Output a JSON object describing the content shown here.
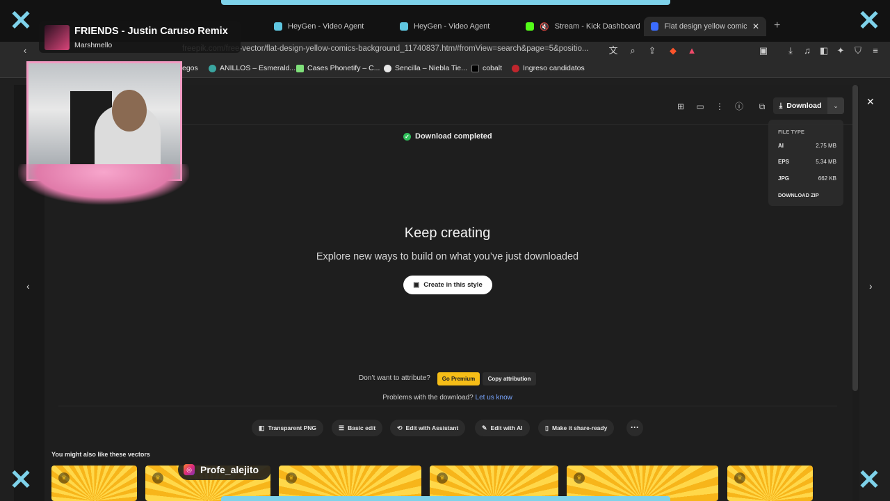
{
  "tabs": [
    {
      "title": "HeyGen - Video Agent",
      "color": "#5fc6e0"
    },
    {
      "title": "HeyGen - Video Agent",
      "color": "#5fc6e0"
    },
    {
      "title": "Stream - Kick Dashboard",
      "color": "#53fc18"
    },
    {
      "title": "Flat design yellow comics b",
      "color": "#3b6cff",
      "active": true
    }
  ],
  "address": {
    "url": "freepik.com/free-vector/flat-design-yellow-comics-background_11740837.htm#fromView=search&page=5&positio..."
  },
  "bookmarks": [
    {
      "label": "egos"
    },
    {
      "label": "ANILLOS – Esmerald..."
    },
    {
      "label": "Cases Phonetify – C..."
    },
    {
      "label": "Sencilla – Niebla Tie..."
    },
    {
      "label": "cobalt"
    },
    {
      "label": "Ingreso candidatos"
    }
  ],
  "download": {
    "button_label": "Download",
    "menu_header": "FILE TYPE",
    "files": [
      {
        "type": "AI",
        "size": "2.75 MB"
      },
      {
        "type": "EPS",
        "size": "5.34 MB"
      },
      {
        "type": "JPG",
        "size": "662 KB"
      }
    ],
    "zip_label": "DOWNLOAD ZIP"
  },
  "status": {
    "completed": "Download completed"
  },
  "hero": {
    "title": "Keep creating",
    "subtitle": "Explore new ways to build on what you’ve just downloaded",
    "cta": "Create in this style"
  },
  "attribution": {
    "question": "Don’t want to attribute?",
    "premium": "Go Premium",
    "copy": "Copy attribution",
    "problems": "Problems with the download?",
    "problems_link": "Let us know"
  },
  "actions": [
    {
      "label": "Transparent PNG",
      "icon": "image-icon"
    },
    {
      "label": "Basic edit",
      "icon": "sliders-icon"
    },
    {
      "label": "Edit with Assistant",
      "icon": "assistant-icon"
    },
    {
      "label": "Edit with AI",
      "icon": "ai-icon"
    },
    {
      "label": "Make it share-ready",
      "icon": "phone-icon"
    }
  ],
  "suggestions": {
    "title": "You might also like these vectors"
  },
  "overlay": {
    "song_title": "FRIENDS - Justin Caruso Remix",
    "song_artist": "Marshmello",
    "handle": "Profe_alejito"
  }
}
